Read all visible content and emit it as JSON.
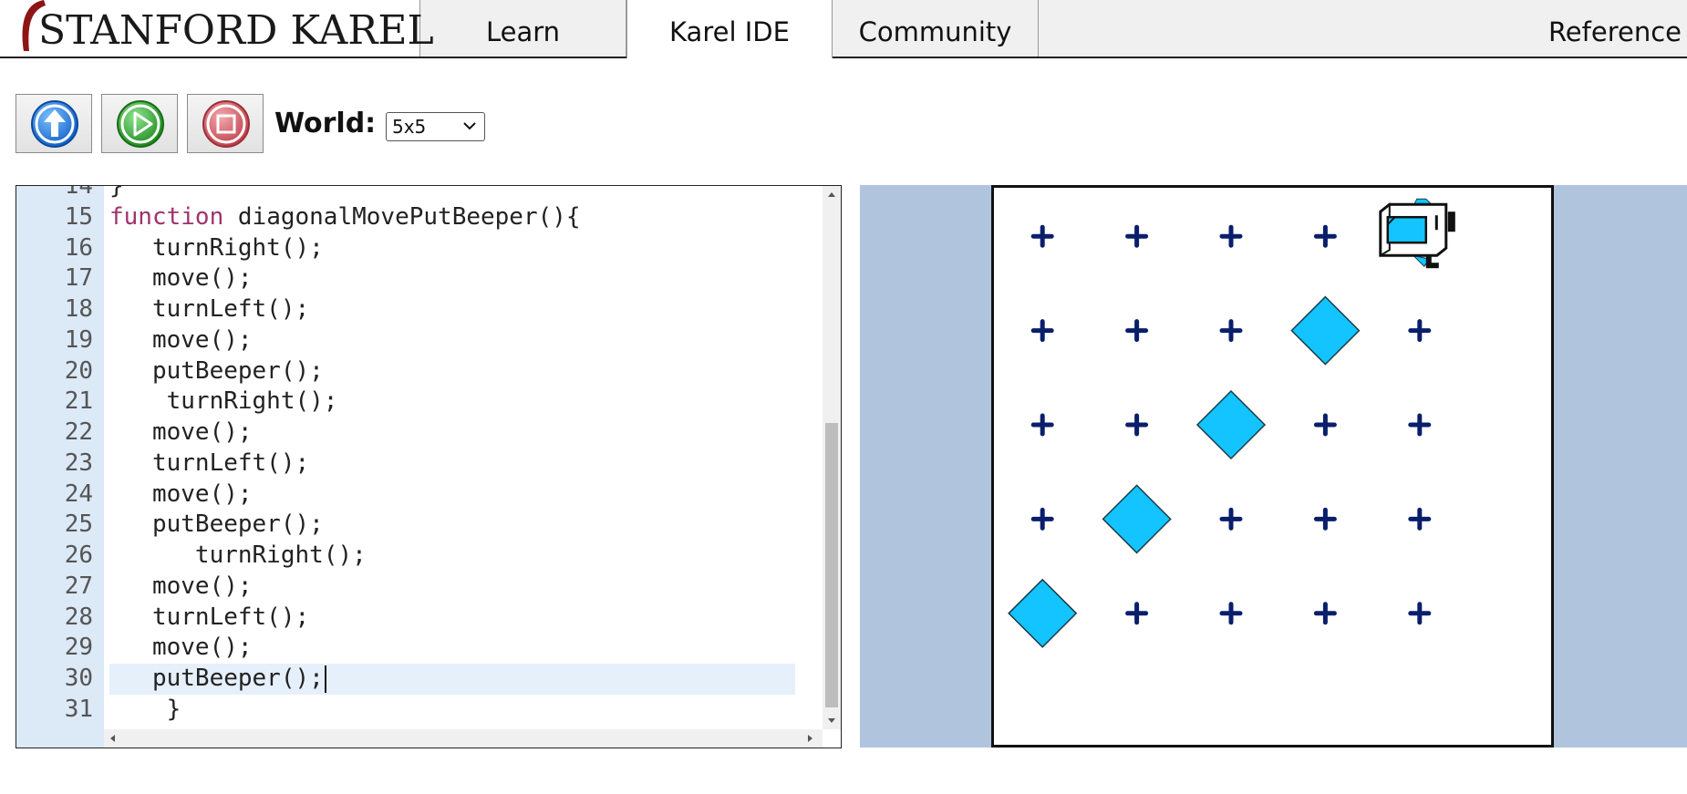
{
  "nav": {
    "logo_text": "STANFORD KAREL",
    "tabs": [
      {
        "label": "Learn"
      },
      {
        "label": "Karel IDE"
      },
      {
        "label": "Community"
      },
      {
        "label": "Reference"
      }
    ],
    "active_tab": "Karel IDE"
  },
  "toolbar": {
    "upload_icon": "upload-arrow-icon",
    "run_icon": "play-icon",
    "stop_icon": "stop-icon",
    "world_label": "World:",
    "world_selected": "5x5",
    "colors": {
      "upload": "#1e7be0",
      "run": "#2e9e2e",
      "stop": "#d25a62"
    }
  },
  "editor": {
    "active_line": 30,
    "lines": [
      {
        "num": "14",
        "text": "}"
      },
      {
        "num": "15",
        "text": "function diagonalMovePutBeeper(){"
      },
      {
        "num": "16",
        "text": "   turnRight();"
      },
      {
        "num": "17",
        "text": "   move();"
      },
      {
        "num": "18",
        "text": "   turnLeft();"
      },
      {
        "num": "19",
        "text": "   move();"
      },
      {
        "num": "20",
        "text": "   putBeeper();"
      },
      {
        "num": "21",
        "text": "    turnRight();"
      },
      {
        "num": "22",
        "text": "   move();"
      },
      {
        "num": "23",
        "text": "   turnLeft();"
      },
      {
        "num": "24",
        "text": "   move();"
      },
      {
        "num": "25",
        "text": "   putBeeper();"
      },
      {
        "num": "26",
        "text": "      turnRight();"
      },
      {
        "num": "27",
        "text": "   move();"
      },
      {
        "num": "28",
        "text": "   turnLeft();"
      },
      {
        "num": "29",
        "text": "   move();"
      },
      {
        "num": "30",
        "text": "   putBeeper();"
      },
      {
        "num": "31",
        "text": "    }"
      }
    ],
    "keyword_color": "#a0326e",
    "gutter_color": "#dce9f7"
  },
  "world": {
    "size": [
      5,
      5
    ],
    "background_color": "#b0c4de",
    "beeper_color": "#13c4ff",
    "corner_color": "#0a1f6b",
    "beepers": [
      [
        1,
        1
      ],
      [
        2,
        2
      ],
      [
        3,
        3
      ],
      [
        4,
        4
      ]
    ],
    "karel": {
      "street": 5,
      "avenue": 5,
      "facing": "north"
    }
  }
}
